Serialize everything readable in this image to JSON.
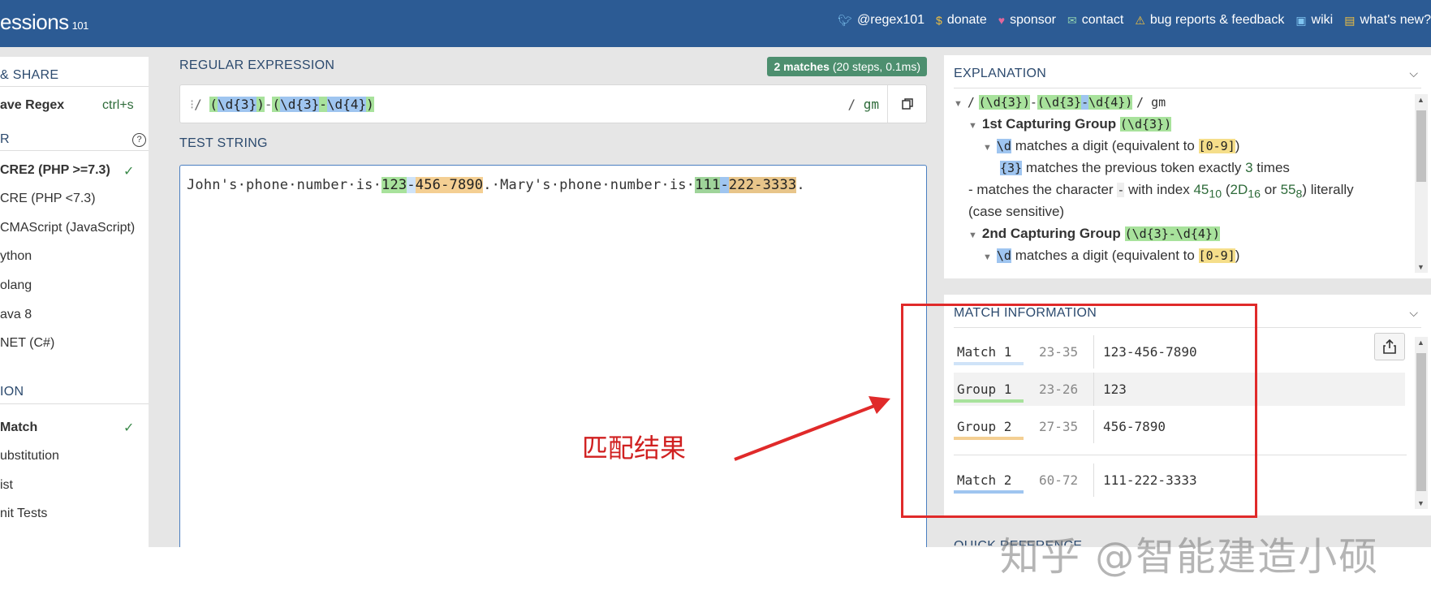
{
  "app": {
    "logo_text": "essions",
    "logo_suffix": "101"
  },
  "topnav": [
    {
      "icon": "twitter-icon",
      "label": "@regex101"
    },
    {
      "icon": "dollar-icon",
      "label": "donate"
    },
    {
      "icon": "heart-icon",
      "label": "sponsor"
    },
    {
      "icon": "mail-icon",
      "label": "contact"
    },
    {
      "icon": "warning-icon",
      "label": "bug reports & feedback"
    },
    {
      "icon": "wiki-icon",
      "label": "wiki"
    },
    {
      "icon": "whats-new-icon",
      "label": "what's new?"
    }
  ],
  "sidebar": {
    "share_heading": "& SHARE",
    "save_label": "ave Regex",
    "save_shortcut": "ctrl+s",
    "flavor_heading": "R",
    "help_icon": "question-circle-icon",
    "flavors": [
      {
        "label": "CRE2 (PHP >=7.3)",
        "selected": true
      },
      {
        "label": "CRE (PHP <7.3)",
        "selected": false
      },
      {
        "label": "CMAScript (JavaScript)",
        "selected": false
      },
      {
        "label": "ython",
        "selected": false
      },
      {
        "label": "olang",
        "selected": false
      },
      {
        "label": "ava 8",
        "selected": false
      },
      {
        "label": "NET (C#)",
        "selected": false
      }
    ],
    "function_heading": "ION",
    "functions": [
      {
        "label": "Match",
        "selected": true
      },
      {
        "label": "ubstitution",
        "selected": false
      },
      {
        "label": "ist",
        "selected": false
      },
      {
        "label": "nit Tests",
        "selected": false
      }
    ]
  },
  "regex_section": {
    "label": "REGULAR EXPRESSION",
    "badge_count": "2 matches",
    "badge_detail": "(20 steps, 0.1ms)",
    "delimiter_open": "/",
    "group1_open": "(",
    "group1_token": "\\d{3}",
    "group1_close": ")",
    "dash": "-",
    "group2_open": "(",
    "group2_token_a": "\\d{3}",
    "group2_dash": "-",
    "group2_token_b": "\\d{4}",
    "group2_close": ")",
    "delimiter_close": "/",
    "flags": "gm"
  },
  "test_section": {
    "label": "TEST STRING",
    "seg1": "John's·phone·number·is·",
    "m1_g1": "123",
    "m1_dash": "-",
    "m1_g2": "456-7890",
    "seg2": ".·Mary's·phone·number·is·",
    "m2_g1": "111",
    "m2_dash": "-",
    "m2_g2": "222-3333",
    "seg3": "."
  },
  "annotation": {
    "text": "匹配结果"
  },
  "explanation": {
    "title": "EXPLANATION",
    "line1_slash": "/",
    "line1_g1": "(\\d{3})",
    "line1_dash": "-",
    "line1_g2a": "(\\d{3}",
    "line1_g2dash": "-",
    "line1_g2b": "\\d{4})",
    "line1_end": "/ gm",
    "group1_title": "1st Capturing Group",
    "group1_token": "(\\d{3})",
    "d_token": "\\d",
    "d_desc": "matches a digit (equivalent to",
    "d_range": "[0-9]",
    "d_close": ")",
    "q_token": "{3}",
    "q_desc": "matches the previous token exactly",
    "q_num": "3",
    "q_suffix": "times",
    "dash_prefix": "-",
    "dash_desc": "matches the character",
    "dash_char": "-",
    "dash_index": "with index",
    "dash_dec": "45",
    "dash_dec_sub": "10",
    "dash_hex": "2D",
    "dash_hex_sub": "16",
    "dash_or": "or",
    "dash_oct": "55",
    "dash_oct_sub": "8",
    "dash_literal": "literally",
    "dash_case": "(case sensitive)",
    "group2_title": "2nd Capturing Group",
    "group2_token": "(\\d{3}-\\d{4})",
    "d2_token": "\\d",
    "d2_desc": "matches a digit (equivalent to",
    "d2_range": "[0-9]",
    "d2_close": ")"
  },
  "match_info": {
    "title": "MATCH INFORMATION",
    "rows": [
      {
        "label": "Match 1",
        "range": "23-35",
        "value": "123-456-7890",
        "color": "#cfe3f8"
      },
      {
        "label": "Group 1",
        "range": "23-26",
        "value": "123",
        "color": "#a8e29c"
      },
      {
        "label": "Group 2",
        "range": "27-35",
        "value": "456-7890",
        "color": "#f4cf93"
      },
      {
        "label": "Match 2",
        "range": "60-72",
        "value": "111-222-3333",
        "color": "#9fc5f0"
      }
    ]
  },
  "quick_ref": {
    "title": "QUICK REFERENCE"
  },
  "watermark": {
    "text": "知乎 @智能建造小硕"
  }
}
